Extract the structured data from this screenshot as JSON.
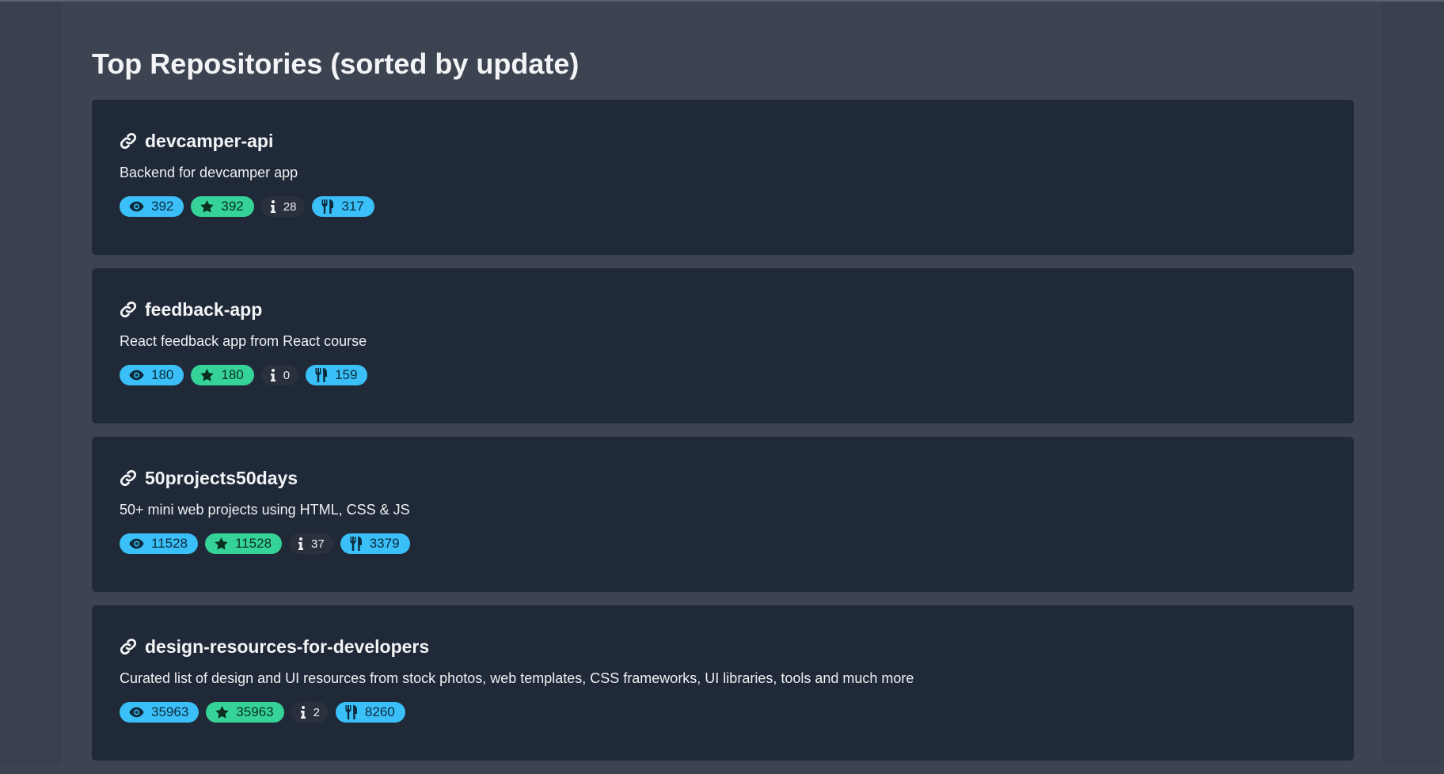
{
  "page": {
    "heading": "Top Repositories (sorted by update)"
  },
  "colors": {
    "background": "#3d4451",
    "card": "#202938",
    "info": "#3abff8",
    "success": "#36d399",
    "neutral": "#2a303c"
  },
  "icons": {
    "title": "link-icon",
    "watchers": "eye-icon",
    "stars": "star-icon",
    "issues": "info-icon",
    "forks": "utensils-icon"
  },
  "repos": [
    {
      "name": "devcamper-api",
      "description": "Backend for devcamper app",
      "watchers": "392",
      "stars": "392",
      "issues": "28",
      "forks": "317"
    },
    {
      "name": "feedback-app",
      "description": "React feedback app from React course",
      "watchers": "180",
      "stars": "180",
      "issues": "0",
      "forks": "159"
    },
    {
      "name": "50projects50days",
      "description": "50+ mini web projects using HTML, CSS & JS",
      "watchers": "11528",
      "stars": "11528",
      "issues": "37",
      "forks": "3379"
    },
    {
      "name": "design-resources-for-developers",
      "description": "Curated list of design and UI resources from stock photos, web templates, CSS frameworks, UI libraries, tools and much more",
      "watchers": "35963",
      "stars": "35963",
      "issues": "2",
      "forks": "8260"
    }
  ]
}
